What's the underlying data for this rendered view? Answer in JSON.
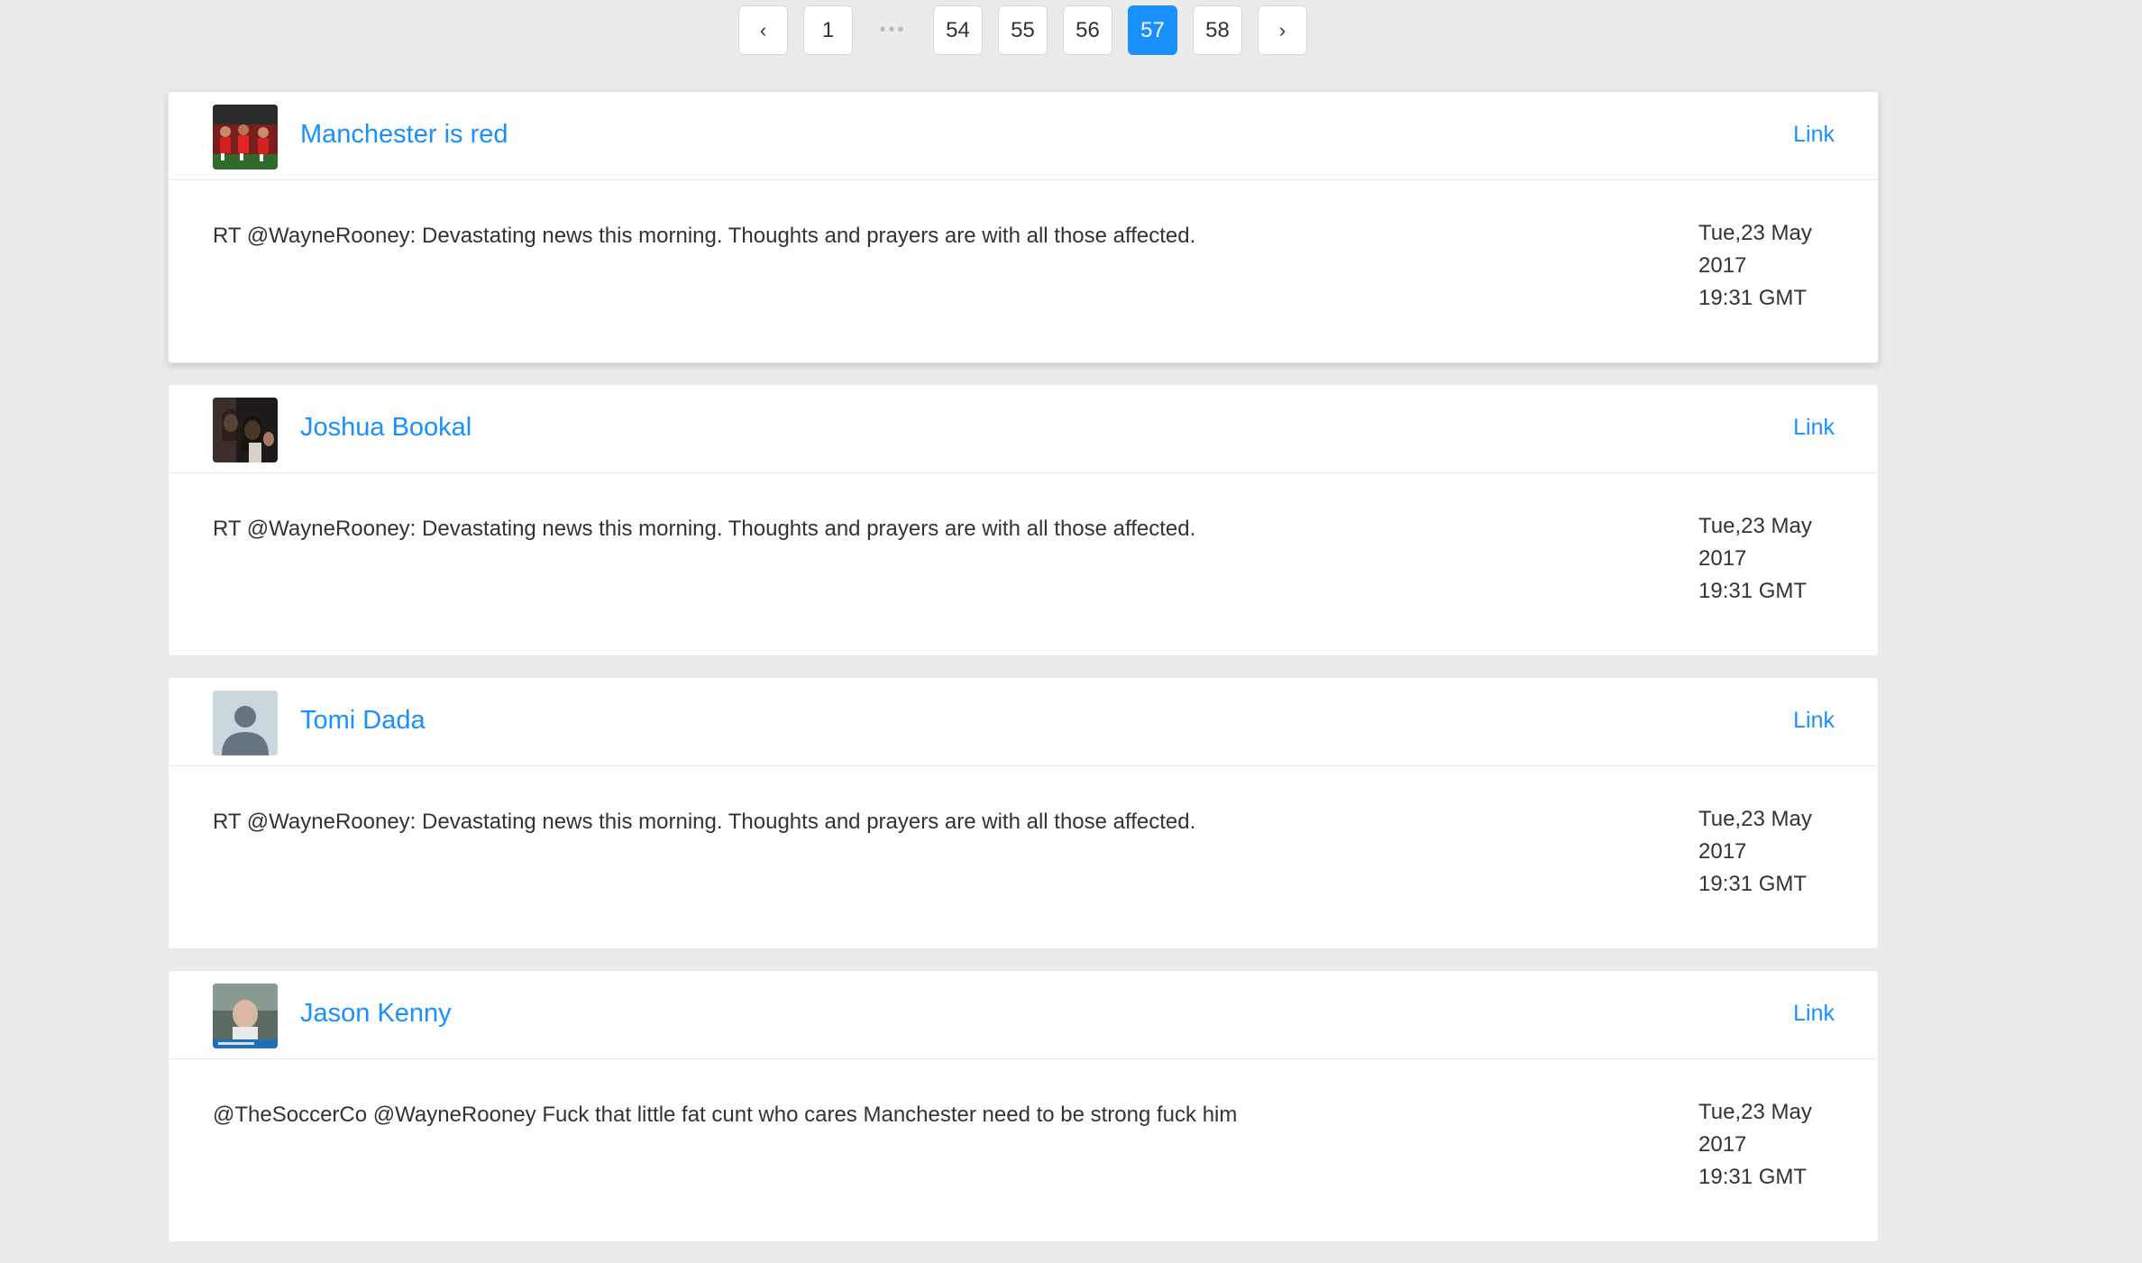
{
  "pagination": {
    "prev_label": "‹",
    "next_label": "›",
    "ellipsis": "•••",
    "pages": [
      "1",
      "54",
      "55",
      "56",
      "57",
      "58"
    ],
    "current": "57"
  },
  "posts": [
    {
      "name": "Manchester is red",
      "link_label": "Link",
      "text": "RT @WayneRooney: Devastating news this morning. Thoughts and prayers are with all those affected.",
      "date_line1": "Tue,23 May",
      "date_line2": "2017",
      "date_line3": "19:31 GMT"
    },
    {
      "name": "Joshua Bookal",
      "link_label": "Link",
      "text": "RT @WayneRooney: Devastating news this morning. Thoughts and prayers are with all those affected.",
      "date_line1": "Tue,23 May",
      "date_line2": "2017",
      "date_line3": "19:31 GMT"
    },
    {
      "name": "Tomi Dada",
      "link_label": "Link",
      "text": "RT @WayneRooney: Devastating news this morning. Thoughts and prayers are with all those affected.",
      "date_line1": "Tue,23 May",
      "date_line2": "2017",
      "date_line3": "19:31 GMT"
    },
    {
      "name": "Jason Kenny",
      "link_label": "Link",
      "text": "@TheSoccerCo @WayneRooney Fuck that little fat cunt who cares Manchester need to be strong fuck him",
      "date_line1": "Tue,23 May",
      "date_line2": "2017",
      "date_line3": "19:31 GMT"
    }
  ],
  "colors": {
    "accent": "#1890ff",
    "background": "#ebebeb",
    "card": "#ffffff",
    "text": "#333333"
  }
}
